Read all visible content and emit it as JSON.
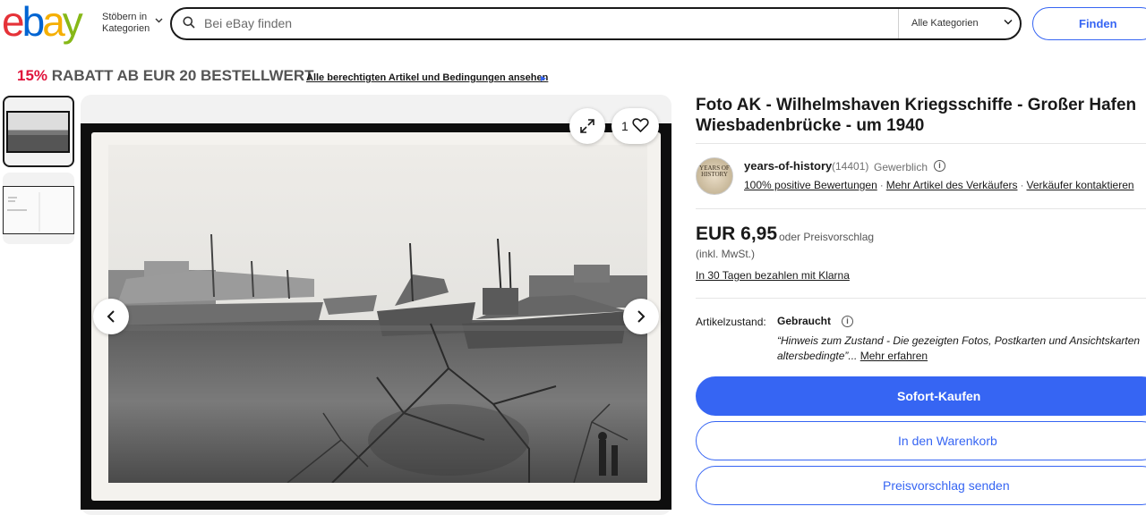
{
  "header": {
    "logo_letters": [
      "e",
      "b",
      "a",
      "y"
    ],
    "logo_colors": [
      "#e53238",
      "#0064d2",
      "#f5af02",
      "#86b817"
    ],
    "browse_line1": "Stöbern in",
    "browse_line2": "Kategorien",
    "search_placeholder": "Bei eBay finden",
    "category_label": "Alle Kategorien",
    "find_label": "Finden"
  },
  "promo": {
    "percent": "15%",
    "text": "RABATT AB EUR 20 BESTELLWERT",
    "link": "Alle berechtigten Artikel und Bedingungen ansehen",
    "arrow": "▶"
  },
  "gallery": {
    "watch_count": "1",
    "thumbnail_count": 2
  },
  "listing": {
    "title": "Foto AK - Wilhelmshaven Kriegsschiffe - Großer Hafen Wiesbadenbrücke - um 1940",
    "seller": {
      "avatar_text": "YEARS OF HISTORY",
      "name": "years-of-history",
      "count": "(14401)",
      "type": "Gewerblich",
      "positive": "100% positive Bewertungen",
      "more_items": "Mehr Artikel des Verkäufers",
      "contact": "Verkäufer kontaktieren"
    },
    "price": "EUR 6,95",
    "offer_text": "oder Preisvorschlag",
    "vat_text": "(inkl. MwSt.)",
    "klarna_text": "In 30 Tagen bezahlen mit Klarna",
    "condition_label": "Artikelzustand:",
    "condition_value": "Gebraucht",
    "condition_note": "“Hinweis zum Zustand - Die gezeigten Fotos, Postkarten und Ansichtskarten",
    "condition_note2": "altersbedingte”...",
    "condition_more": "Mehr erfahren",
    "buy_now": "Sofort-Kaufen",
    "add_cart": "In den Warenkorb",
    "send_offer": "Preisvorschlag senden"
  },
  "colors": {
    "accent": "#3665f3",
    "promo_red": "#e0123b"
  }
}
